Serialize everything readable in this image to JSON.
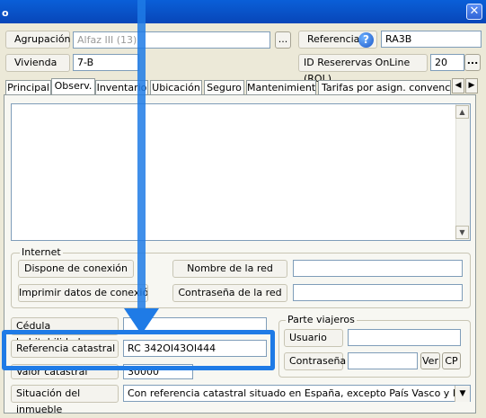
{
  "window": {
    "title_fragment": "o",
    "close_glyph": "✕"
  },
  "fields": {
    "agrupacion_label": "Agrupación",
    "agrupacion_value": "Alfaz III (13)",
    "ellipsis_button": "...",
    "referencia_label": "Referencia",
    "help_glyph": "?",
    "referencia_value": "RA3B",
    "vivienda_label": "Vivienda",
    "vivienda_value": "7-B",
    "id_reservas_label": "ID Reserervas OnLine (ROL)",
    "id_reservas_value": "20",
    "id_reservas_button": "..."
  },
  "tabs": [
    {
      "label": "Principal"
    },
    {
      "label": "Observ."
    },
    {
      "label": "Inventario"
    },
    {
      "label": "Ubicación"
    },
    {
      "label": "Seguro"
    },
    {
      "label": "Mantenimiento"
    },
    {
      "label": "Tarifas por asign. convencionales"
    }
  ],
  "active_tab": "Observ.",
  "internet": {
    "legend": "Internet",
    "dispone_button": "Dispone de conexión",
    "imprimir_button": "Imprimir datos de conexión",
    "nombre_red_label": "Nombre de la red",
    "nombre_red_value": "",
    "contrasena_label": "Contraseña de la red",
    "contrasena_value": ""
  },
  "bottom": {
    "cedula_label": "Cédula habitabilidad",
    "cedula_value": "",
    "ref_catastral_label": "Referencia catastral",
    "ref_catastral_value": "RC 342OI43OI444",
    "valor_catastral_label": "Valor catastral",
    "valor_catastral_value": "30000",
    "situacion_label": "Situación del inmueble",
    "situacion_value": "Con referencia catastral situado en España, excepto País Vasco y Navarra"
  },
  "parte_viajeros": {
    "legend": "Parte viajeros",
    "usuario_label": "Usuario",
    "usuario_value": "",
    "contrasena_label": "Contraseña",
    "contrasena_value": "",
    "ver_button": "Ver",
    "cp_button": "CP"
  },
  "colors": {
    "highlight": "#1f7be6",
    "titlebar": "#0a5fd8",
    "dialog_bg": "#ece9d8"
  }
}
